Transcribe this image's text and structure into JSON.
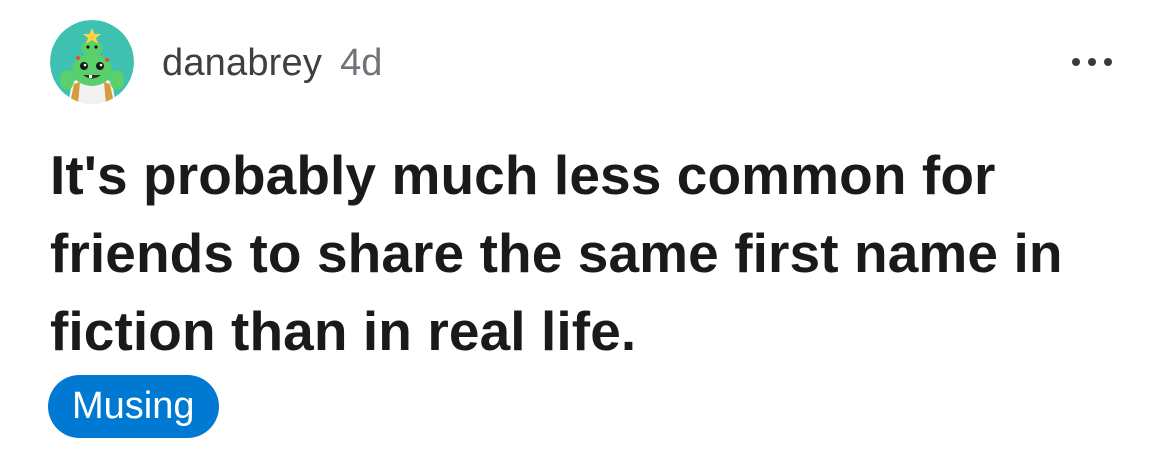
{
  "post": {
    "author": "danabrey",
    "age": "4d",
    "title": "It's probably much less common for friends to share the same first name in fiction than in real life.",
    "flair": "Musing"
  },
  "icons": {
    "avatar": "snoo-avatar-icon",
    "more": "more-options-icon"
  },
  "colors": {
    "flair_background": "#0079d3",
    "flair_text": "#ffffff",
    "title_text": "#1a1a1b",
    "meta_text": "#6f7478",
    "avatar_background": "#3ec1b0"
  }
}
